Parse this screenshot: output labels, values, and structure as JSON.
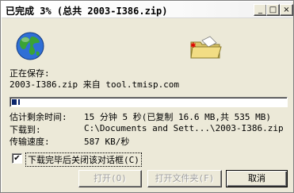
{
  "window": {
    "title": "已完成 3% (总共 2003-I386.zip)",
    "minimize_glyph": "_",
    "maximize_glyph": "□",
    "close_glyph": "×"
  },
  "status": {
    "saving_label": "正在保存:",
    "saving_detail": "2003-I386.zip 来自 tool.tmisp.com"
  },
  "progress": {
    "percent": 3,
    "fill_color": "#0a246a"
  },
  "details": {
    "time_left_label": "估计剩余时间:",
    "time_left_value": "15 分钟 5 秒(已复制 16.6 MB,共 535 MB)",
    "download_to_label": "下载到:",
    "download_to_value": "C:\\Documents and Sett...\\2003-I386.zip",
    "speed_label": "传输速度:",
    "speed_value": "587 KB/秒"
  },
  "checkbox": {
    "checked": true,
    "label": "下载完毕后关闭该对话框(C)"
  },
  "buttons": {
    "open": "打开(O)",
    "open_folder": "打开文件夹(F)",
    "cancel": "取消"
  },
  "icons": {
    "globe": "globe-icon",
    "folder": "open-folder-icon"
  }
}
